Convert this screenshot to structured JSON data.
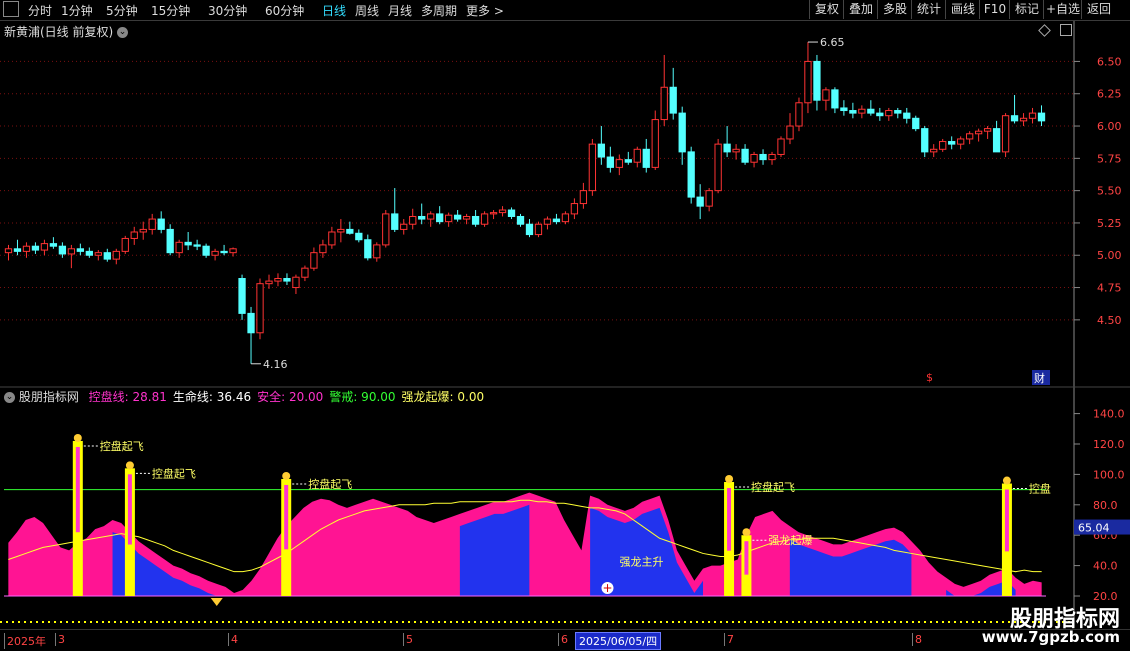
{
  "toolbar": {
    "periods": [
      "分时",
      "1分钟",
      "5分钟",
      "15分钟",
      "30分钟",
      "60分钟",
      "日线",
      "周线",
      "月线",
      "多周期",
      "更多"
    ],
    "active_period": "日线",
    "buttons": [
      "复权",
      "叠加",
      "多股",
      "统计",
      "画线",
      "F10",
      "标记",
      "+自选",
      "返回"
    ]
  },
  "main_panel": {
    "title": "新黄浦(日线 前复权)",
    "price_axis_labels": [
      "6.50",
      "6.25",
      "6.00",
      "5.75",
      "5.50",
      "5.25",
      "5.00",
      "4.75",
      "4.50"
    ],
    "high_label": "6.65",
    "low_label": "4.16",
    "badge_s": "$",
    "badge_cai": "财"
  },
  "indicator_panel": {
    "name": "股朋指标网",
    "items": [
      {
        "label": "控盘线: ",
        "value": "28.81",
        "color": "#ff33cc"
      },
      {
        "label": "生命线: ",
        "value": "36.46",
        "color": "#ffffff"
      },
      {
        "label": "安全: ",
        "value": "20.00",
        "color": "#ff33cc"
      },
      {
        "label": "警戒: ",
        "value": "90.00",
        "color": "#33ff33"
      },
      {
        "label": "强龙起爆: ",
        "value": "0.00",
        "color": "#ffff66"
      }
    ],
    "axis_labels": [
      "140.0",
      "120.0",
      "100.0",
      "80.0",
      "60.0",
      "40.0",
      "20.0"
    ],
    "current_value": "65.04",
    "signals": [
      "控盘起飞",
      "控盘起飞",
      "控盘起飞",
      "强龙起爆",
      "控盘起飞",
      "控盘"
    ],
    "main_rise": "强龙主升"
  },
  "time_axis": {
    "labels": [
      "2025年",
      "3",
      "4",
      "5",
      "6",
      "7",
      "8"
    ],
    "cursor_date": "2025/06/05/四"
  },
  "watermark": {
    "cn": "股朋指标网",
    "url": "www.7gpzb.com"
  },
  "colors": {
    "up": "#ff3333",
    "down": "#54ffff",
    "control": "#ff1493",
    "life": "#ffff33",
    "warn": "#33ff33",
    "blue_fill": "#2233ee",
    "grid": "#7a1010"
  },
  "chart_data": {
    "type": "candlestick",
    "price_range": [
      4.16,
      6.65
    ],
    "candles": [
      [
        5.02,
        5.08,
        4.96,
        5.05
      ],
      [
        5.05,
        5.12,
        5.0,
        5.03
      ],
      [
        5.03,
        5.1,
        4.98,
        5.07
      ],
      [
        5.07,
        5.1,
        5.01,
        5.04
      ],
      [
        5.04,
        5.12,
        5.0,
        5.09
      ],
      [
        5.09,
        5.14,
        5.05,
        5.07
      ],
      [
        5.07,
        5.1,
        4.98,
        5.01
      ],
      [
        5.01,
        5.08,
        4.9,
        5.05
      ],
      [
        5.05,
        5.09,
        5.0,
        5.03
      ],
      [
        5.03,
        5.06,
        4.98,
        5.0
      ],
      [
        5.0,
        5.04,
        4.96,
        5.02
      ],
      [
        5.02,
        5.05,
        4.95,
        4.97
      ],
      [
        4.97,
        5.05,
        4.93,
        5.03
      ],
      [
        5.03,
        5.15,
        5.01,
        5.13
      ],
      [
        5.13,
        5.22,
        5.08,
        5.18
      ],
      [
        5.18,
        5.26,
        5.12,
        5.2
      ],
      [
        5.2,
        5.32,
        5.16,
        5.28
      ],
      [
        5.28,
        5.34,
        5.17,
        5.2
      ],
      [
        5.2,
        5.24,
        5.0,
        5.02
      ],
      [
        5.02,
        5.12,
        4.98,
        5.1
      ],
      [
        5.1,
        5.18,
        5.04,
        5.08
      ],
      [
        5.08,
        5.12,
        5.04,
        5.07
      ],
      [
        5.07,
        5.09,
        4.98,
        5.0
      ],
      [
        5.0,
        5.05,
        4.96,
        5.03
      ],
      [
        5.03,
        5.08,
        5.0,
        5.02
      ],
      [
        5.02,
        5.06,
        4.99,
        5.05
      ],
      [
        4.82,
        4.85,
        4.5,
        4.55
      ],
      [
        4.55,
        4.6,
        4.16,
        4.4
      ],
      [
        4.4,
        4.82,
        4.35,
        4.78
      ],
      [
        4.78,
        4.85,
        4.74,
        4.8
      ],
      [
        4.8,
        4.86,
        4.76,
        4.82
      ],
      [
        4.82,
        4.86,
        4.77,
        4.8
      ],
      [
        4.75,
        4.85,
        4.7,
        4.83
      ],
      [
        4.83,
        4.92,
        4.8,
        4.9
      ],
      [
        4.9,
        5.06,
        4.88,
        5.02
      ],
      [
        5.02,
        5.12,
        4.98,
        5.08
      ],
      [
        5.08,
        5.22,
        5.05,
        5.18
      ],
      [
        5.18,
        5.28,
        5.1,
        5.2
      ],
      [
        5.2,
        5.26,
        5.16,
        5.17
      ],
      [
        5.17,
        5.2,
        5.1,
        5.12
      ],
      [
        5.12,
        5.16,
        4.96,
        4.98
      ],
      [
        4.98,
        5.1,
        4.95,
        5.08
      ],
      [
        5.08,
        5.35,
        5.06,
        5.32
      ],
      [
        5.32,
        5.52,
        5.18,
        5.2
      ],
      [
        5.2,
        5.28,
        5.16,
        5.24
      ],
      [
        5.24,
        5.36,
        5.2,
        5.3
      ],
      [
        5.3,
        5.4,
        5.24,
        5.28
      ],
      [
        5.28,
        5.34,
        5.22,
        5.32
      ],
      [
        5.32,
        5.38,
        5.24,
        5.26
      ],
      [
        5.26,
        5.33,
        5.22,
        5.31
      ],
      [
        5.31,
        5.35,
        5.26,
        5.28
      ],
      [
        5.28,
        5.32,
        5.24,
        5.3
      ],
      [
        5.3,
        5.35,
        5.22,
        5.24
      ],
      [
        5.24,
        5.34,
        5.22,
        5.32
      ],
      [
        5.32,
        5.35,
        5.28,
        5.33
      ],
      [
        5.33,
        5.38,
        5.3,
        5.35
      ],
      [
        5.35,
        5.37,
        5.28,
        5.3
      ],
      [
        5.3,
        5.32,
        5.22,
        5.24
      ],
      [
        5.24,
        5.28,
        5.14,
        5.16
      ],
      [
        5.16,
        5.26,
        5.14,
        5.24
      ],
      [
        5.24,
        5.3,
        5.2,
        5.28
      ],
      [
        5.28,
        5.32,
        5.24,
        5.26
      ],
      [
        5.26,
        5.34,
        5.24,
        5.32
      ],
      [
        5.32,
        5.44,
        5.28,
        5.4
      ],
      [
        5.4,
        5.56,
        5.36,
        5.5
      ],
      [
        5.5,
        5.9,
        5.46,
        5.86
      ],
      [
        5.86,
        6.0,
        5.7,
        5.76
      ],
      [
        5.76,
        5.84,
        5.64,
        5.68
      ],
      [
        5.68,
        5.78,
        5.62,
        5.74
      ],
      [
        5.74,
        5.8,
        5.7,
        5.72
      ],
      [
        5.72,
        5.84,
        5.68,
        5.82
      ],
      [
        5.82,
        5.9,
        5.64,
        5.68
      ],
      [
        5.68,
        6.12,
        5.66,
        6.05
      ],
      [
        6.05,
        6.55,
        6.0,
        6.3
      ],
      [
        6.3,
        6.45,
        6.05,
        6.1
      ],
      [
        6.1,
        6.15,
        5.7,
        5.8
      ],
      [
        5.8,
        5.84,
        5.4,
        5.45
      ],
      [
        5.45,
        5.55,
        5.28,
        5.38
      ],
      [
        5.38,
        5.52,
        5.34,
        5.5
      ],
      [
        5.5,
        5.9,
        5.48,
        5.86
      ],
      [
        5.86,
        6.0,
        5.76,
        5.8
      ],
      [
        5.8,
        5.86,
        5.74,
        5.82
      ],
      [
        5.82,
        5.86,
        5.7,
        5.72
      ],
      [
        5.72,
        5.8,
        5.68,
        5.78
      ],
      [
        5.78,
        5.82,
        5.7,
        5.74
      ],
      [
        5.74,
        5.8,
        5.7,
        5.78
      ],
      [
        5.78,
        5.92,
        5.76,
        5.9
      ],
      [
        5.9,
        6.1,
        5.86,
        6.0
      ],
      [
        6.0,
        6.22,
        5.96,
        6.18
      ],
      [
        6.18,
        6.65,
        6.1,
        6.5
      ],
      [
        6.5,
        6.55,
        6.12,
        6.2
      ],
      [
        6.2,
        6.3,
        6.12,
        6.28
      ],
      [
        6.28,
        6.3,
        6.1,
        6.14
      ],
      [
        6.14,
        6.2,
        6.08,
        6.12
      ],
      [
        6.12,
        6.18,
        6.06,
        6.1
      ],
      [
        6.1,
        6.16,
        6.06,
        6.13
      ],
      [
        6.13,
        6.2,
        6.08,
        6.1
      ],
      [
        6.1,
        6.14,
        6.04,
        6.08
      ],
      [
        6.08,
        6.14,
        6.04,
        6.12
      ],
      [
        6.12,
        6.14,
        6.06,
        6.1
      ],
      [
        6.1,
        6.14,
        6.02,
        6.06
      ],
      [
        6.06,
        6.08,
        5.96,
        5.98
      ],
      [
        5.98,
        6.0,
        5.76,
        5.8
      ],
      [
        5.8,
        5.86,
        5.76,
        5.82
      ],
      [
        5.82,
        5.9,
        5.8,
        5.88
      ],
      [
        5.88,
        5.92,
        5.82,
        5.86
      ],
      [
        5.86,
        5.92,
        5.82,
        5.9
      ],
      [
        5.9,
        5.96,
        5.86,
        5.94
      ],
      [
        5.94,
        5.98,
        5.88,
        5.96
      ],
      [
        5.96,
        6.0,
        5.9,
        5.98
      ],
      [
        5.98,
        6.04,
        5.94,
        5.8
      ],
      [
        5.8,
        6.1,
        5.76,
        6.08
      ],
      [
        6.08,
        6.24,
        6.02,
        6.04
      ],
      [
        6.04,
        6.1,
        6.0,
        6.06
      ],
      [
        6.06,
        6.14,
        6.02,
        6.1
      ],
      [
        6.1,
        6.16,
        6.0,
        6.04
      ]
    ],
    "indicator": {
      "safe_level": 20,
      "warn_level": 90,
      "control": [
        55,
        62,
        70,
        72,
        68,
        60,
        52,
        50,
        55,
        58,
        64,
        66,
        70,
        68,
        62,
        56,
        52,
        48,
        44,
        40,
        38,
        35,
        33,
        30,
        28,
        26,
        22,
        24,
        30,
        38,
        48,
        58,
        66,
        72,
        78,
        82,
        84,
        83,
        80,
        78,
        80,
        82,
        84,
        82,
        80,
        78,
        76,
        72,
        70,
        68,
        70,
        72,
        74,
        76,
        78,
        80,
        82,
        82,
        84,
        86,
        88,
        86,
        84,
        82,
        70,
        60,
        50,
        86,
        84,
        80,
        78,
        76,
        78,
        82,
        84,
        86,
        70,
        50,
        40,
        30,
        38,
        40,
        40,
        42,
        44,
        60,
        72,
        74,
        76,
        70,
        66,
        62,
        60,
        58,
        56,
        54,
        54,
        56,
        58,
        60,
        62,
        64,
        65,
        62,
        56,
        50,
        42,
        36,
        32,
        28,
        26,
        28,
        30,
        34,
        36,
        38,
        32,
        28,
        30,
        29
      ],
      "life": [
        44,
        46,
        48,
        50,
        52,
        53,
        54,
        55,
        56,
        57,
        58,
        59,
        60,
        61,
        60,
        59,
        57,
        55,
        53,
        50,
        48,
        46,
        44,
        42,
        40,
        38,
        36,
        36,
        37,
        39,
        42,
        45,
        48,
        52,
        56,
        60,
        64,
        67,
        70,
        72,
        74,
        76,
        77,
        78,
        79,
        80,
        80,
        80,
        80,
        81,
        81,
        81,
        82,
        82,
        82,
        82,
        82,
        82,
        82,
        83,
        83,
        82,
        82,
        81,
        81,
        80,
        79,
        78,
        78,
        77,
        76,
        74,
        70,
        66,
        62,
        58,
        56,
        54,
        52,
        50,
        48,
        47,
        46,
        46,
        47,
        49,
        51,
        53,
        55,
        56,
        57,
        57,
        58,
        58,
        58,
        58,
        57,
        56,
        55,
        54,
        53,
        52,
        50,
        49,
        48,
        47,
        46,
        45,
        44,
        43,
        42,
        41,
        40,
        39,
        38,
        37,
        36,
        37,
        36,
        36
      ],
      "blue": [
        0,
        0,
        0,
        0,
        0,
        0,
        0,
        0,
        0,
        0,
        0,
        0,
        40,
        45,
        48,
        46,
        50,
        52,
        55,
        58,
        60,
        62,
        64,
        66,
        68,
        0,
        0,
        0,
        0,
        0,
        0,
        0,
        0,
        0,
        0,
        0,
        0,
        0,
        0,
        0,
        0,
        0,
        0,
        0,
        0,
        0,
        0,
        0,
        0,
        0,
        0,
        0,
        0,
        0,
        0,
        0,
        0,
        0,
        0,
        0,
        0,
        0,
        0,
        0,
        0,
        0,
        0,
        0,
        0,
        0,
        0,
        0,
        0,
        0,
        0,
        0,
        0,
        0,
        0,
        0,
        0,
        0,
        0,
        0,
        0,
        0,
        0,
        0,
        0,
        0,
        0,
        0,
        0,
        0,
        0,
        0,
        0,
        0,
        0,
        0,
        0,
        0,
        0,
        0,
        0,
        0,
        0,
        0,
        0,
        0,
        0,
        0,
        0,
        0,
        0,
        0,
        0,
        0,
        0,
        0
      ]
    }
  }
}
